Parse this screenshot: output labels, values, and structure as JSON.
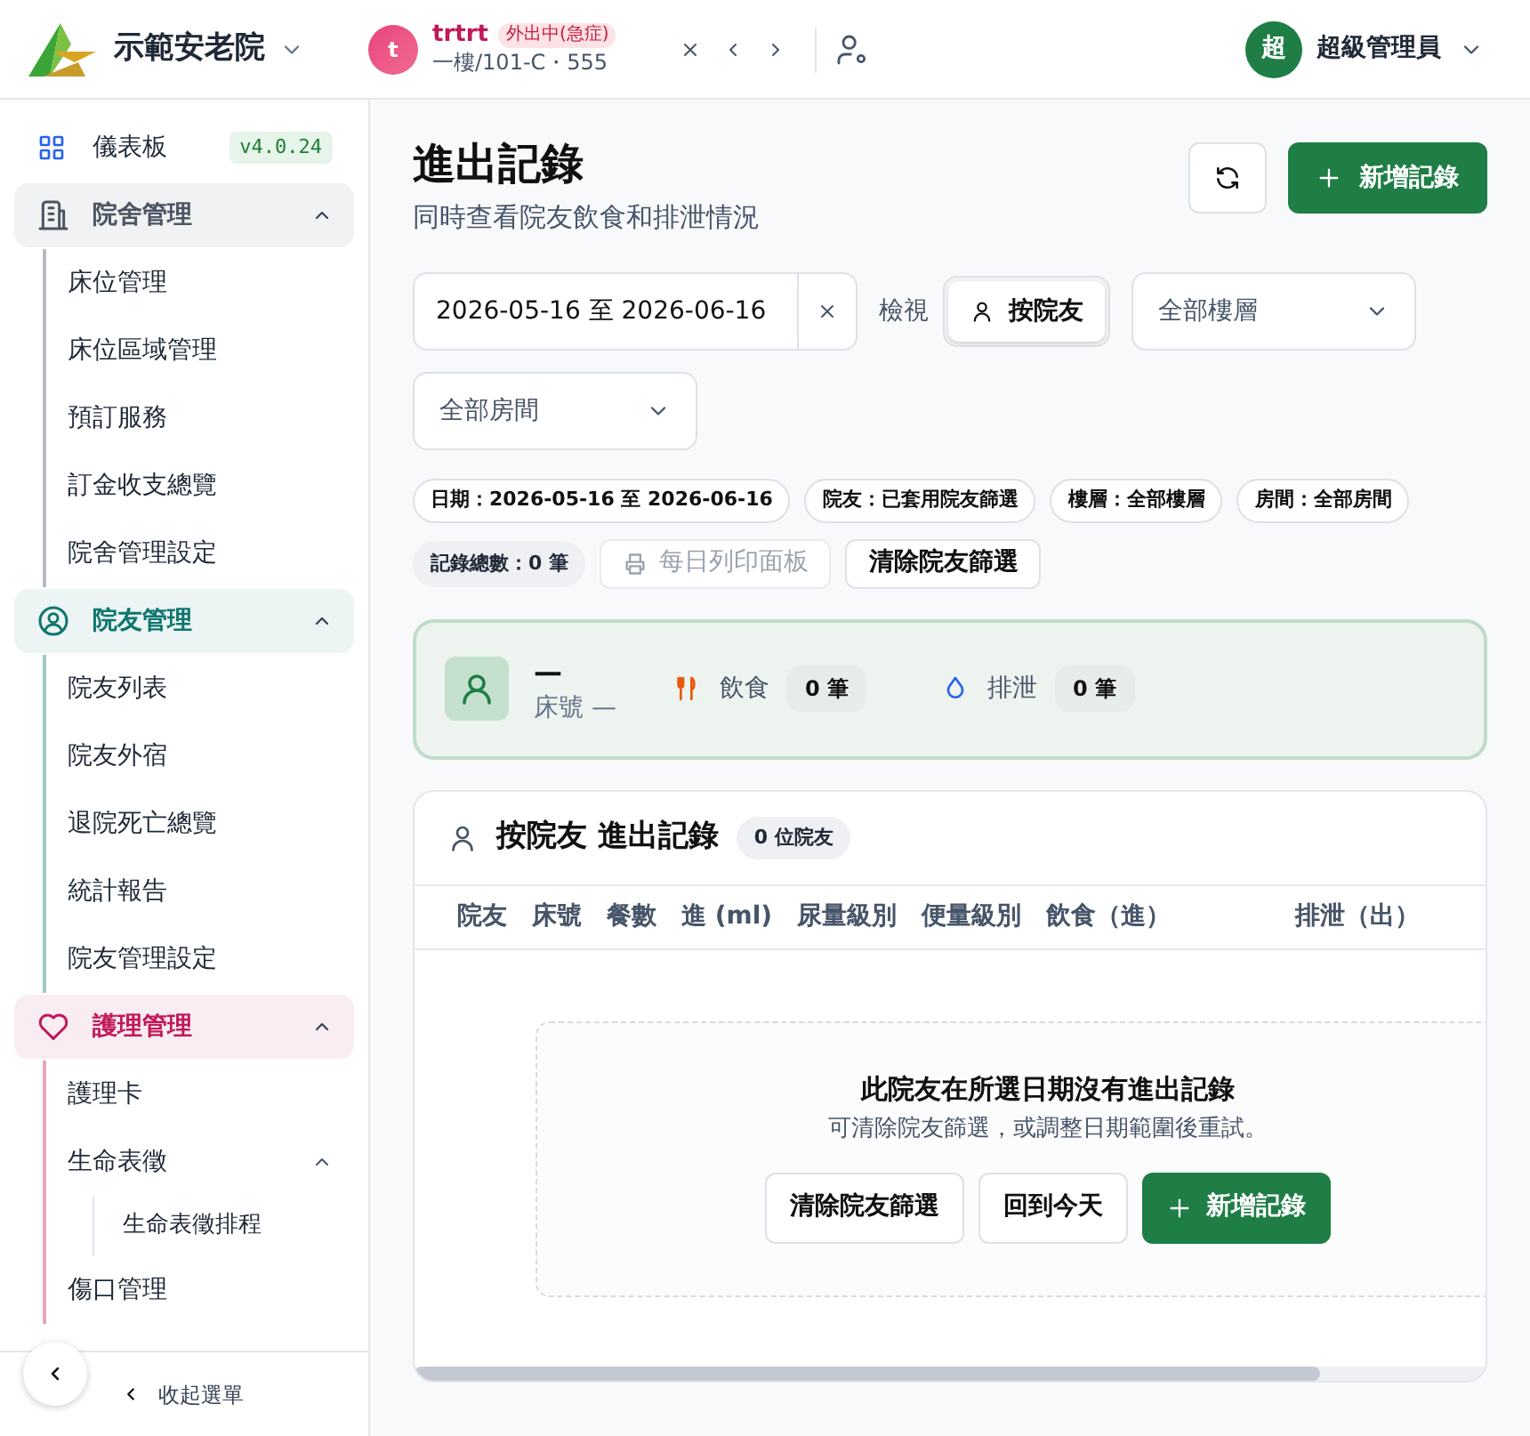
{
  "topbar": {
    "org_name": "示範安老院",
    "resident": {
      "avatar_letter": "t",
      "name": "trtrt",
      "status": "外出中(急症)",
      "location": "一樓/101-C・555"
    },
    "user": {
      "avatar_letter": "超",
      "name": "超級管理員"
    }
  },
  "sidebar": {
    "items": [
      {
        "kind": "link",
        "label": "儀表板",
        "badge": "v4.0.24"
      },
      {
        "kind": "group",
        "label": "院舍管理",
        "color": "#4b5563",
        "expanded": true,
        "children": [
          {
            "label": "床位管理"
          },
          {
            "label": "床位區域管理"
          },
          {
            "label": "預訂服務"
          },
          {
            "label": "訂金收支總覽"
          },
          {
            "label": "院舍管理設定"
          }
        ]
      },
      {
        "kind": "group",
        "label": "院友管理",
        "color": "#0f766e",
        "expanded": true,
        "children": [
          {
            "label": "院友列表"
          },
          {
            "label": "院友外宿"
          },
          {
            "label": "退院死亡總覽"
          },
          {
            "label": "統計報告"
          },
          {
            "label": "院友管理設定"
          }
        ]
      },
      {
        "kind": "group",
        "label": "護理管理",
        "color": "#c2185b",
        "expanded": true,
        "children": [
          {
            "label": "護理卡"
          },
          {
            "label": "生命表徵",
            "expanded": true,
            "children": [
              {
                "label": "生命表徵排程"
              }
            ]
          },
          {
            "label": "傷口管理"
          }
        ]
      }
    ],
    "collapse_label": "收起選單"
  },
  "page": {
    "title": "進出記錄",
    "subtitle": "同時查看院友飲食和排泄情況",
    "add_button": "新增記錄",
    "filters": {
      "date_range": "2026-05-16 至 2026-06-16",
      "view_label": "檢視",
      "view_options": [
        {
          "label": "按院友",
          "selected": true
        }
      ],
      "floor": "全部樓層",
      "room": "全部房間"
    },
    "chips": [
      "日期：2026-05-16 至 2026-06-16",
      "院友：已套用院友篩選",
      "樓層：全部樓層",
      "房間：全部房間"
    ],
    "total": "記錄總數：0 筆",
    "print_button": {
      "label": "每日列印面板",
      "disabled": true
    },
    "clear_button": "清除院友篩選",
    "summary": {
      "name": "—",
      "bed": "床號 —",
      "stats": [
        {
          "kind": "food",
          "label": "飲食",
          "count": "0 筆"
        },
        {
          "kind": "output",
          "label": "排泄",
          "count": "0 筆"
        }
      ]
    },
    "table": {
      "title": "按院友 進出記錄",
      "badge": "0 位院友",
      "columns": [
        "院友",
        "床號",
        "餐數",
        "進 (ml)",
        "尿量級別",
        "便量級別",
        "飲食（進）",
        "排泄（出）"
      ],
      "empty": {
        "title": "此院友在所選日期沒有進出記錄",
        "message": "可清除院友篩選，或調整日期範圍後重試。",
        "buttons": [
          {
            "kind": "outline",
            "label": "清除院友篩選"
          },
          {
            "kind": "outline",
            "label": "回到今天"
          },
          {
            "kind": "primary",
            "label": "新增記錄"
          }
        ]
      }
    }
  }
}
